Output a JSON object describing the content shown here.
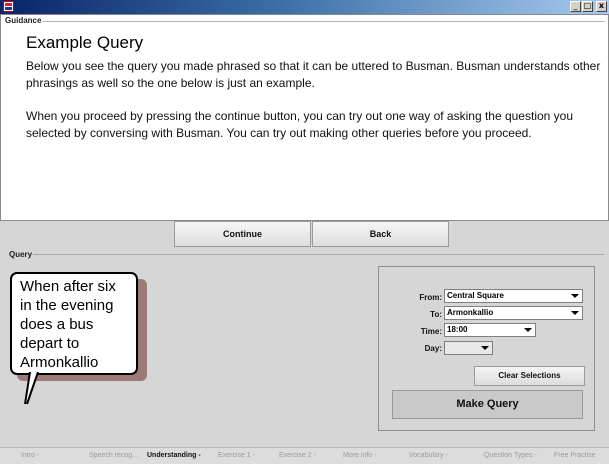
{
  "window": {
    "minimize": "_",
    "maximize": "□",
    "close": "x",
    "icon": "app-icon"
  },
  "guidance": {
    "legend": "Guidance",
    "heading": "Example Query",
    "paragraph1": "Below you see the query you made phrased so that it can be uttered to Busman. Busman understands other phrasings as well so the one below is just an example.",
    "paragraph2": "When you proceed by pressing the continue button, you can try out one way of asking the question you selected by conversing with Busman. You can try out making other queries before you proceed."
  },
  "nav": {
    "continue_label": "Continue",
    "back_label": "Back"
  },
  "query": {
    "legend": "Query",
    "bubble_text": "When after six\nin the evening\ndoes a bus\ndepart to\nArmonkallio"
  },
  "form": {
    "from_label": "From:",
    "from_value": "Central Square",
    "to_label": "To:",
    "to_value": "Armonkallio",
    "time_label": "Time:",
    "time_value": "18:00",
    "day_label": "Day:",
    "day_value": "",
    "clear_label": "Clear Selections",
    "make_label": "Make Query"
  },
  "status": {
    "steps": [
      {
        "label": "Intro -",
        "active": false
      },
      {
        "label": "Speech recog...",
        "active": false
      },
      {
        "label": "Understanding -",
        "active": true
      },
      {
        "label": "Exercise 1 -",
        "active": false
      },
      {
        "label": "Exercise 2 -",
        "active": false
      },
      {
        "label": "More info -",
        "active": false
      },
      {
        "label": "Vocabulary -",
        "active": false
      },
      {
        "label": "Question Types -",
        "active": false
      },
      {
        "label": "Free Practise",
        "active": false
      }
    ]
  },
  "colors": {
    "titlebar": "#0a246a",
    "background": "#d6d6d6",
    "bubble_shadow": "#9c7a78"
  }
}
